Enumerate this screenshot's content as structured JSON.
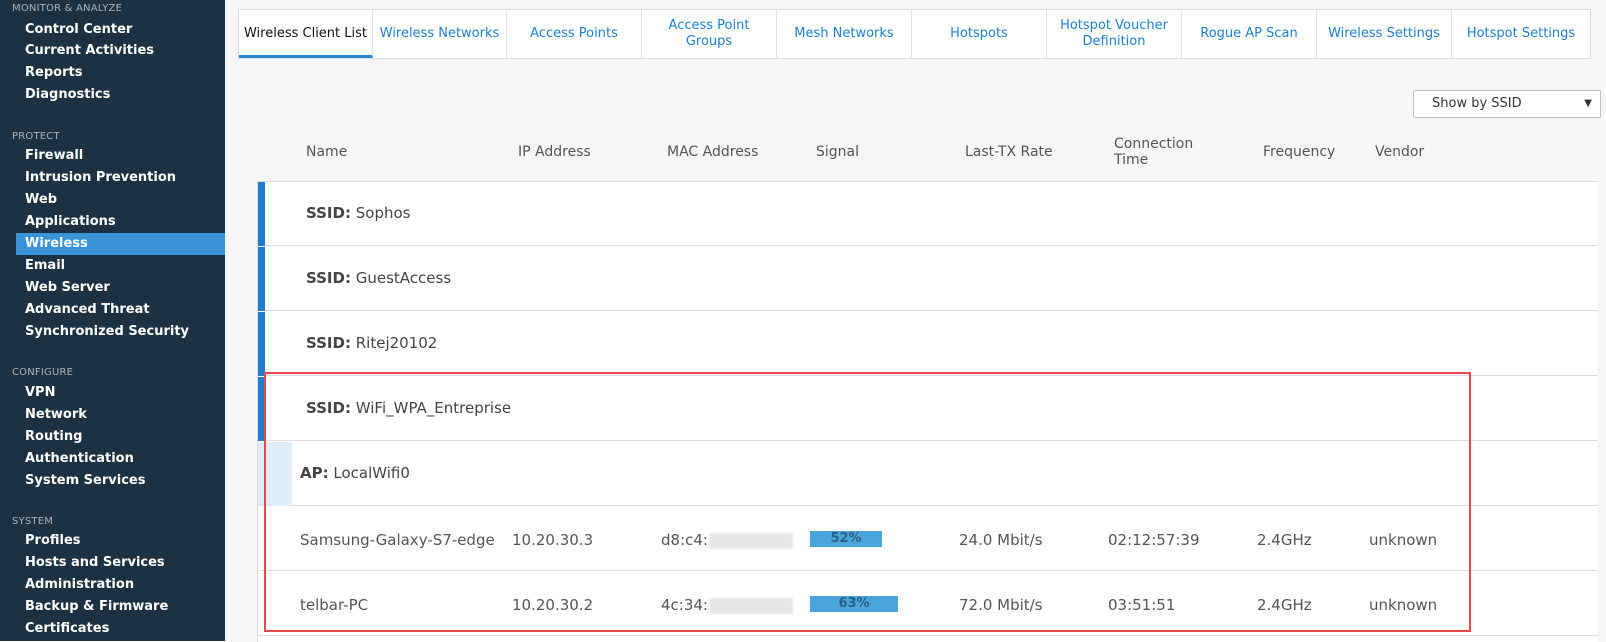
{
  "sidebar": {
    "sections": [
      {
        "title": "MONITOR & ANALYZE",
        "items": [
          "Control Center",
          "Current Activities",
          "Reports",
          "Diagnostics"
        ]
      },
      {
        "title": "PROTECT",
        "items": [
          "Firewall",
          "Intrusion Prevention",
          "Web",
          "Applications",
          "Wireless",
          "Email",
          "Web Server",
          "Advanced Threat",
          "Synchronized Security"
        ]
      },
      {
        "title": "CONFIGURE",
        "items": [
          "VPN",
          "Network",
          "Routing",
          "Authentication",
          "System Services"
        ]
      },
      {
        "title": "SYSTEM",
        "items": [
          "Profiles",
          "Hosts and Services",
          "Administration",
          "Backup & Firmware",
          "Certificates"
        ]
      }
    ],
    "active_item": "Wireless",
    "colors": {
      "background": "#1c3243",
      "active": "#3a93d6"
    }
  },
  "tabs": [
    {
      "label": "Wireless Client List",
      "active": true
    },
    {
      "label": "Wireless Networks"
    },
    {
      "label": "Access Points"
    },
    {
      "label": "Access Point Groups"
    },
    {
      "label": "Mesh Networks"
    },
    {
      "label": "Hotspots"
    },
    {
      "label": "Hotspot Voucher Definition"
    },
    {
      "label": "Rogue AP Scan"
    },
    {
      "label": "Wireless Settings"
    },
    {
      "label": "Hotspot Settings"
    }
  ],
  "view_select": {
    "value": "Show by SSID"
  },
  "columns": [
    "Name",
    "IP Address",
    "MAC Address",
    "Signal",
    "Last-TX Rate",
    "Connection Time",
    "Frequency",
    "Vendor"
  ],
  "ssid_label": "SSID:",
  "ap_label": "AP:",
  "ssids": [
    "Sophos",
    "GuestAccess",
    "Ritej20102",
    "WiFi_WPA_Entreprise"
  ],
  "ap": {
    "name": "LocalWifi0"
  },
  "clients": [
    {
      "name": "Samsung-Galaxy-S7-edge",
      "ip": "10.20.30.3",
      "mac_visible": "d8:c4:",
      "signal": "52%",
      "signal_value": 52,
      "tx_rate": "24.0 Mbit/s",
      "connection_time": "02:12:57:39",
      "frequency": "2.4GHz",
      "vendor": "unknown"
    },
    {
      "name": "telbar-PC",
      "ip": "10.20.30.2",
      "mac_visible": "4c:34:",
      "signal": "63%",
      "signal_value": 63,
      "tx_rate": "72.0 Mbit/s",
      "connection_time": "03:51:51",
      "frequency": "2.4GHz",
      "vendor": "unknown"
    }
  ],
  "colors": {
    "accent": "#1e7fd0",
    "highlight": "#e8474c",
    "signal_bar": "#4aa5dc"
  }
}
